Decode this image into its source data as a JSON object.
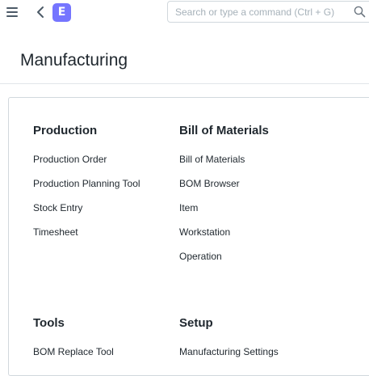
{
  "navbar": {
    "menu_icon": "hamburger-menu-icon",
    "back_icon": "chevron-left-icon",
    "logo_letter": "E",
    "logo_color": "#7575ff",
    "search_placeholder": "Search or type a command (Ctrl + G)",
    "search_value": "",
    "search_icon": "search-icon"
  },
  "page": {
    "title": "Manufacturing"
  },
  "sections": [
    {
      "title": "Production",
      "links": [
        "Production Order",
        "Production Planning Tool",
        "Stock Entry",
        "Timesheet"
      ]
    },
    {
      "title": "Bill of Materials",
      "links": [
        "Bill of Materials",
        "BOM Browser",
        "Item",
        "Workstation",
        "Operation"
      ]
    },
    {
      "title": "Tools",
      "links": [
        "BOM Replace Tool"
      ]
    },
    {
      "title": "Setup",
      "links": [
        "Manufacturing Settings"
      ]
    }
  ]
}
